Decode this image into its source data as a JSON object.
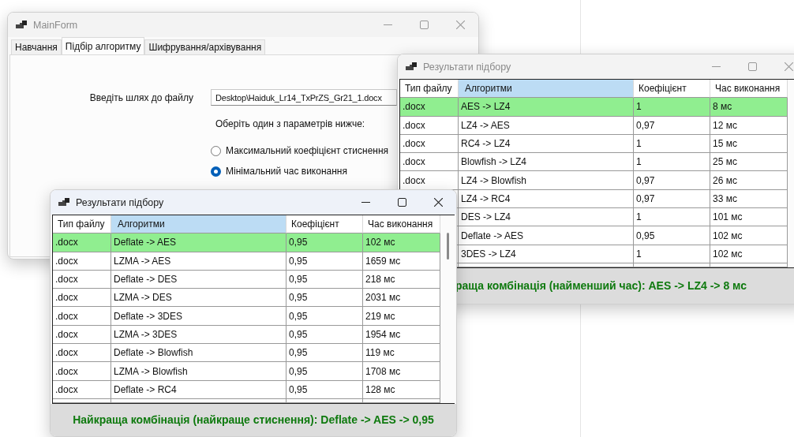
{
  "main_window": {
    "title": "MainForm",
    "active": false,
    "tabs": [
      {
        "label": "Навчання",
        "selected": false
      },
      {
        "label": "Підбір алгоритму",
        "selected": true
      },
      {
        "label": "Шифрування/архівування",
        "selected": false
      }
    ],
    "path_label": "Введіть шлях до файлу",
    "path_value": "Desktop\\Haiduk_Lr14_TxPrZS_Gr21_1.docx",
    "options_label": "Оберіть один з параметрів нижче:",
    "options": [
      {
        "label": "Максимальний коефіцієнт стиснення",
        "selected": false
      },
      {
        "label": "Мінімальний час виконання",
        "selected": true
      }
    ]
  },
  "results_windows": [
    {
      "title": "Результати підбору",
      "active": false,
      "columns": [
        {
          "label": "Тип файлу",
          "selected": false
        },
        {
          "label": "Алгоритми",
          "selected": true
        },
        {
          "label": "Коефіцієнт",
          "selected": false
        },
        {
          "label": "Час виконання",
          "selected": false
        }
      ],
      "rows": [
        {
          "file_type": ".docx",
          "algorithms": "AES -> LZ4",
          "ratio": "1",
          "time": "8 мс",
          "highlighted": true
        },
        {
          "file_type": ".docx",
          "algorithms": "LZ4 -> AES",
          "ratio": "0,97",
          "time": "12 мс",
          "highlighted": false
        },
        {
          "file_type": ".docx",
          "algorithms": "RC4 -> LZ4",
          "ratio": "1",
          "time": "15 мс",
          "highlighted": false
        },
        {
          "file_type": ".docx",
          "algorithms": "Blowfish -> LZ4",
          "ratio": "1",
          "time": "25 мс",
          "highlighted": false
        },
        {
          "file_type": ".docx",
          "algorithms": "LZ4 -> Blowfish",
          "ratio": "0,97",
          "time": "26 мс",
          "highlighted": false
        },
        {
          "algorithms": "LZ4 -> RC4",
          "ratio": "0,97",
          "time": "33 мс",
          "highlighted": false
        },
        {
          "algorithms": "DES -> LZ4",
          "ratio": "1",
          "time": "101 мс",
          "highlighted": false
        },
        {
          "algorithms": "Deflate -> AES",
          "ratio": "0,95",
          "time": "102 мс",
          "highlighted": false
        },
        {
          "algorithms": "3DES -> LZ4",
          "ratio": "1",
          "time": "102 мс",
          "highlighted": false
        }
      ],
      "summary": "раща комбінація (найменший час): AES -> LZ4 -> 8 мс"
    },
    {
      "title": "Результати підбору",
      "active": true,
      "columns": [
        {
          "label": "Тип файлу",
          "selected": false
        },
        {
          "label": "Алгоритми",
          "selected": true
        },
        {
          "label": "Коефіцієнт",
          "selected": false
        },
        {
          "label": "Час виконання",
          "selected": false
        }
      ],
      "rows": [
        {
          "file_type": ".docx",
          "algorithms": "Deflate -> AES",
          "ratio": "0,95",
          "time": "102 мс",
          "highlighted": true
        },
        {
          "file_type": ".docx",
          "algorithms": "LZMA -> AES",
          "ratio": "0,95",
          "time": "1659 мс",
          "highlighted": false
        },
        {
          "file_type": ".docx",
          "algorithms": "Deflate -> DES",
          "ratio": "0,95",
          "time": "218 мс",
          "highlighted": false
        },
        {
          "file_type": ".docx",
          "algorithms": "LZMA -> DES",
          "ratio": "0,95",
          "time": "2031 мс",
          "highlighted": false
        },
        {
          "file_type": ".docx",
          "algorithms": "Deflate -> 3DES",
          "ratio": "0,95",
          "time": "219 мс",
          "highlighted": false
        },
        {
          "file_type": ".docx",
          "algorithms": "LZMA -> 3DES",
          "ratio": "0,95",
          "time": "1954 мс",
          "highlighted": false
        },
        {
          "file_type": ".docx",
          "algorithms": "Deflate -> Blowfish",
          "ratio": "0,95",
          "time": "119 мс",
          "highlighted": false
        },
        {
          "file_type": ".docx",
          "algorithms": "LZMA -> Blowfish",
          "ratio": "0,95",
          "time": "1708 мс",
          "highlighted": false
        },
        {
          "file_type": ".docx",
          "algorithms": "Deflate -> RC4",
          "ratio": "0,95",
          "time": "128 мс",
          "highlighted": false
        }
      ],
      "summary": "Найкраща комбінація (найкраще стиснення): Deflate -> AES -> 0,95"
    }
  ]
}
